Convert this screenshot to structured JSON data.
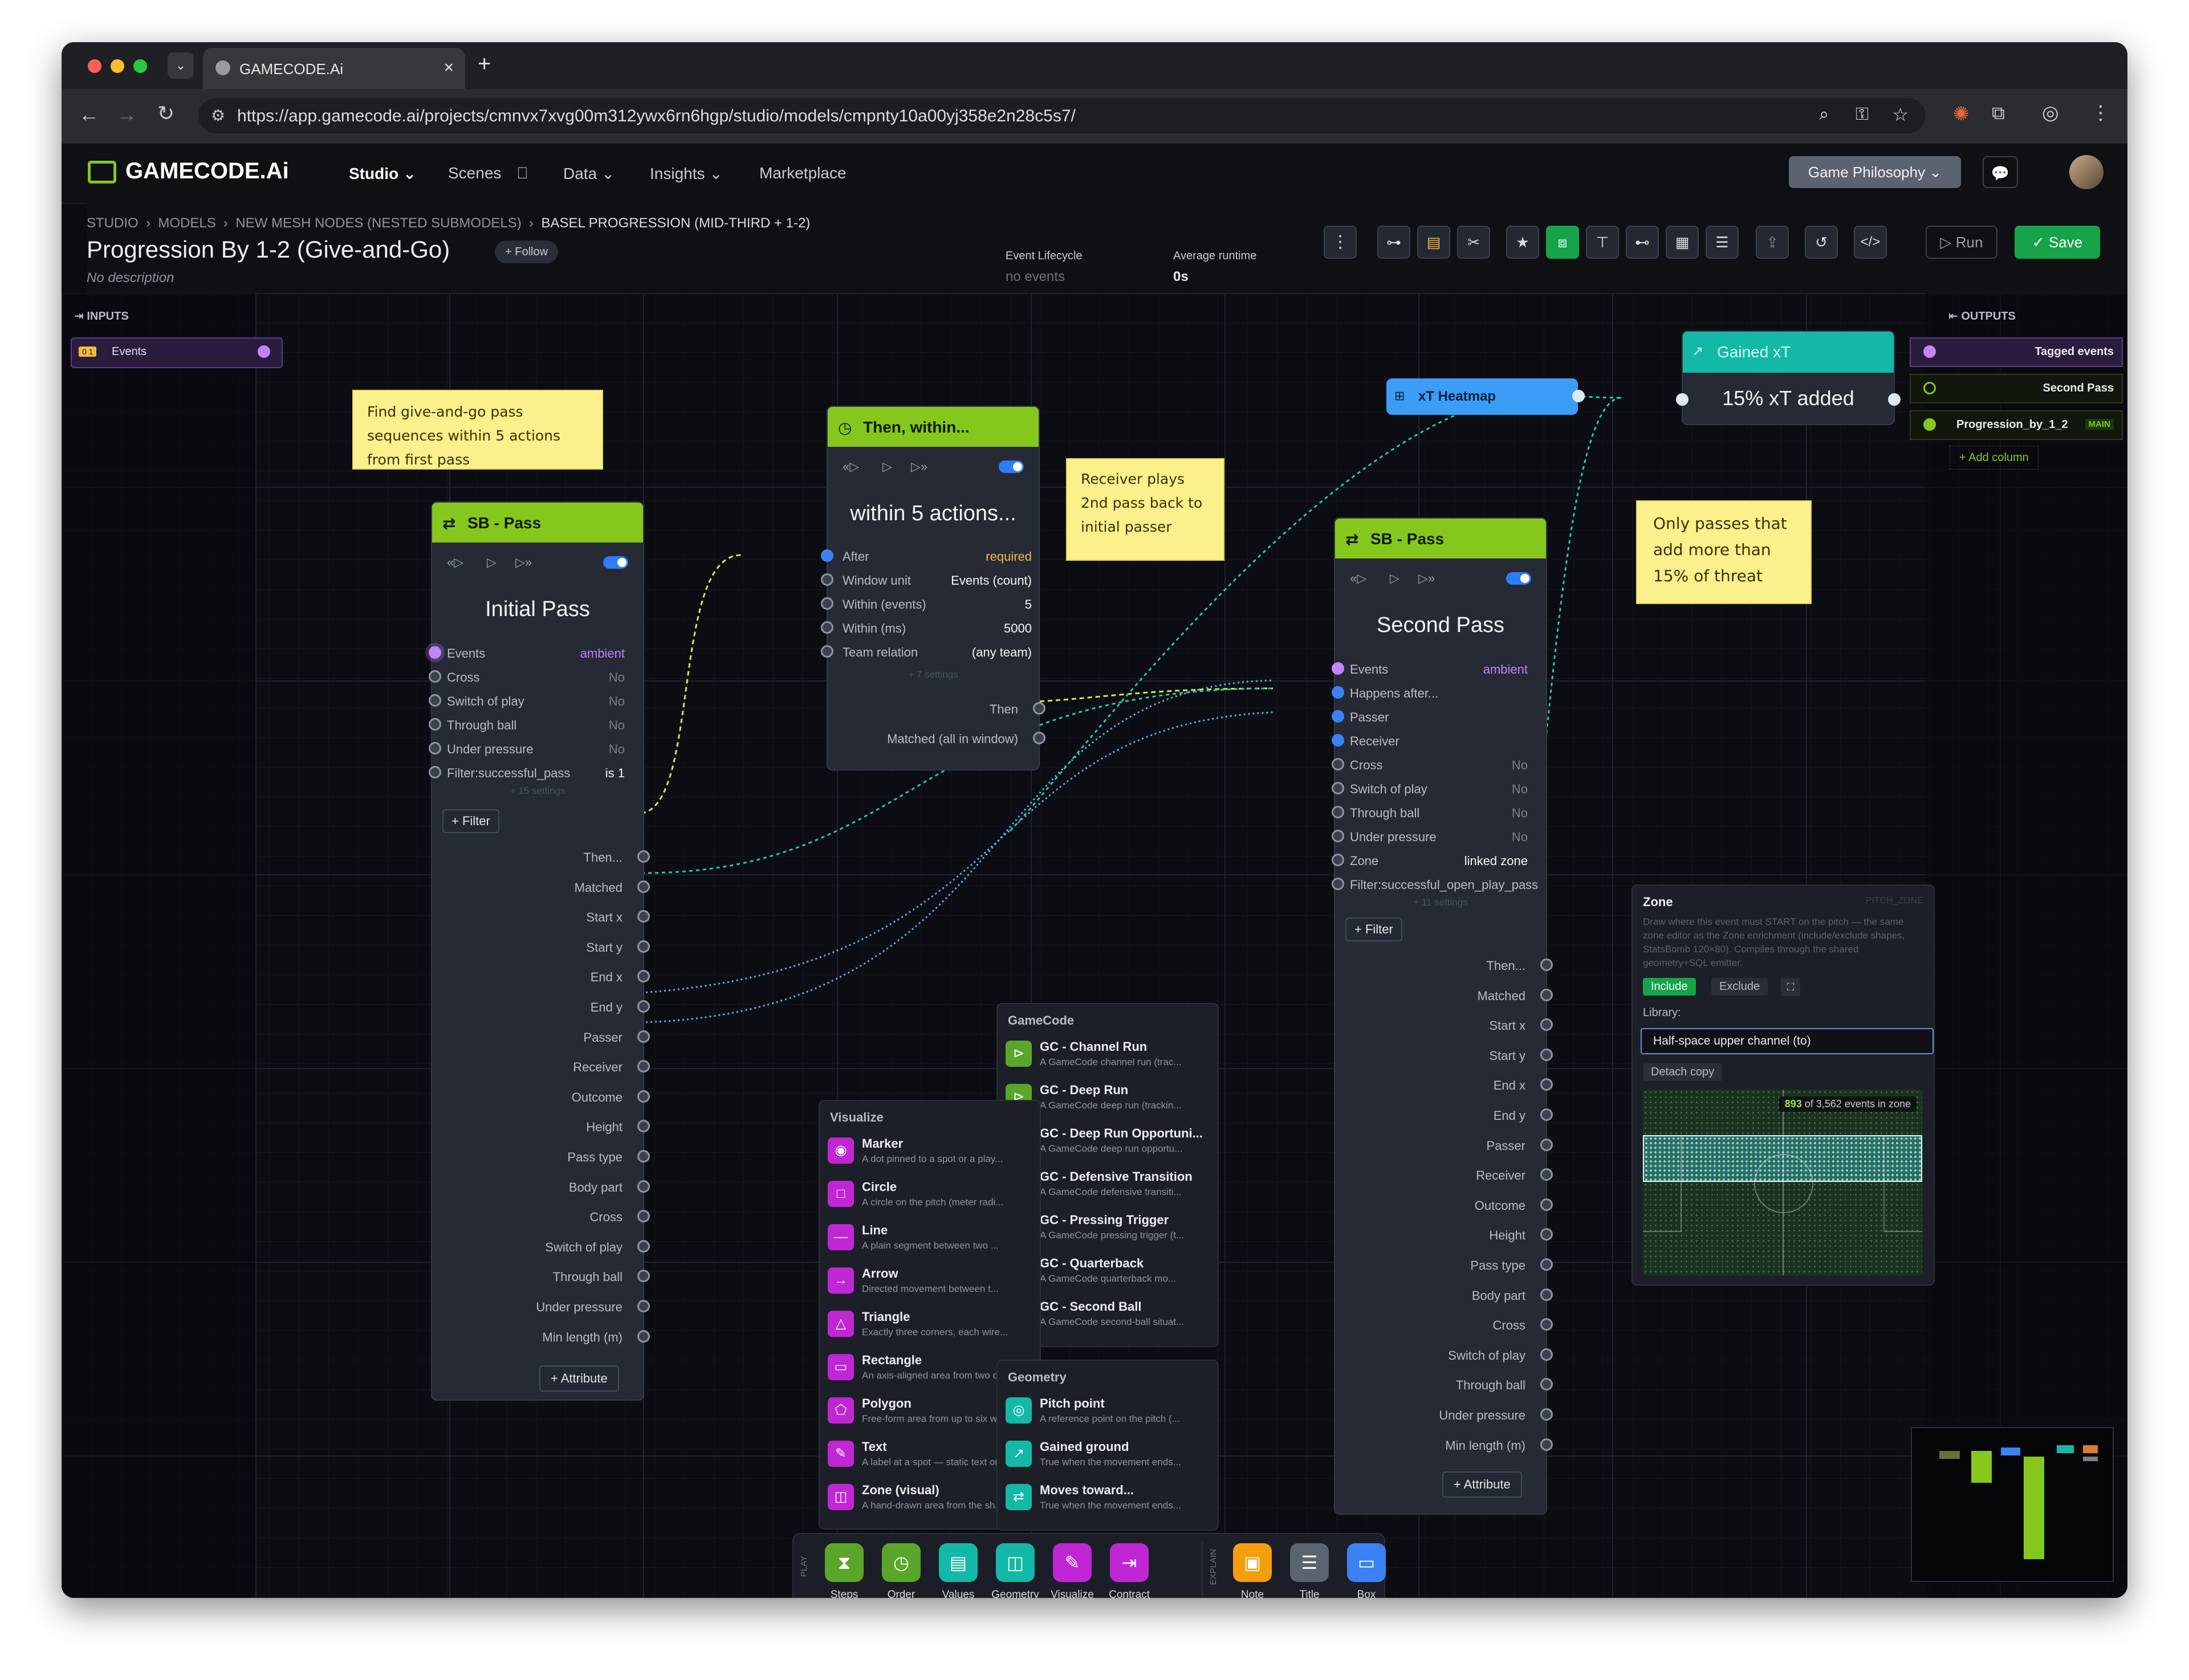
{
  "browser": {
    "tab_title": "GAMECODE.Ai",
    "url": "https://app.gamecode.ai/projects/cmnvx7xvg00m312ywx6rn6hgp/studio/models/cmpnty10a00yj358e2n28c5s7/"
  },
  "app": {
    "logo": "GAMECODE.Ai",
    "nav": [
      "Studio",
      "Scenes",
      "Data",
      "Insights",
      "Marketplace"
    ],
    "philosophy_button": "Game Philosophy"
  },
  "page": {
    "breadcrumb": [
      "STUDIO",
      "MODELS",
      "NEW MESH NODES (NESTED SUBMODELS)",
      "BASEL PROGRESSION (MID-THIRD + 1-2)"
    ],
    "title": "Progression By 1-2 (Give-and-Go)",
    "follow": "+ Follow",
    "description": "No description",
    "event_lifecycle_label": "Event Lifecycle",
    "event_lifecycle_value": "no events",
    "avg_runtime_label": "Average runtime",
    "avg_runtime_value": "0s",
    "run": "Run",
    "save": "Save"
  },
  "inputs": {
    "label": "INPUTS",
    "badge": "0 1",
    "item": "Events"
  },
  "outputs": {
    "label": "OUTPUTS",
    "rows": [
      "Tagged events",
      "Second Pass",
      "Progression_by_1_2"
    ],
    "main_badge": "MAIN",
    "add": "+ Add column"
  },
  "notes": [
    "Find give-and-go pass sequences within 5 actions from first pass",
    "Receiver plays 2nd pass back to initial passer",
    "Only passes that add more than 15% of threat"
  ],
  "node_initial": {
    "header": "SB - Pass",
    "title": "Initial Pass",
    "filters": [
      {
        "label": "Events",
        "value": "ambient"
      },
      {
        "label": "Cross",
        "value": "No"
      },
      {
        "label": "Switch of play",
        "value": "No"
      },
      {
        "label": "Through ball",
        "value": "No"
      },
      {
        "label": "Under pressure",
        "value": "No"
      },
      {
        "label": "Filter:successful_pass",
        "value": "is 1"
      }
    ],
    "more": "+ 15 settings",
    "filter_btn": "+ Filter",
    "outputs": [
      "Then...",
      "Matched",
      "Start x",
      "Start y",
      "End x",
      "End y",
      "Passer",
      "Receiver",
      "Outcome",
      "Height",
      "Pass type",
      "Body part",
      "Cross",
      "Switch of play",
      "Through ball",
      "Under pressure",
      "Min length (m)"
    ],
    "attr_btn": "+ Attribute"
  },
  "node_within": {
    "header": "Then, within...",
    "title": "within 5 actions...",
    "rows": [
      {
        "label": "After",
        "value": "required"
      },
      {
        "label": "Window unit",
        "value": "Events (count)"
      },
      {
        "label": "Within (events)",
        "value": "5"
      },
      {
        "label": "Within (ms)",
        "value": "5000"
      },
      {
        "label": "Team relation",
        "value": "(any team)"
      }
    ],
    "more": "+ 7 settings",
    "outputs": [
      "Then",
      "Matched (all in window)"
    ]
  },
  "node_second": {
    "header": "SB - Pass",
    "title": "Second Pass",
    "filters": [
      {
        "label": "Events",
        "value": "ambient"
      },
      {
        "label": "Happens after...",
        "value": ""
      },
      {
        "label": "Passer",
        "value": ""
      },
      {
        "label": "Receiver",
        "value": ""
      },
      {
        "label": "Cross",
        "value": "No"
      },
      {
        "label": "Switch of play",
        "value": "No"
      },
      {
        "label": "Through ball",
        "value": "No"
      },
      {
        "label": "Under pressure",
        "value": "No"
      },
      {
        "label": "Zone",
        "value": "linked zone"
      },
      {
        "label": "Filter:successful_open_play_pass",
        "value": ""
      }
    ],
    "more": "+ 11 settings",
    "filter_btn": "+ Filter",
    "outputs": [
      "Then...",
      "Matched",
      "Start x",
      "Start y",
      "End x",
      "End y",
      "Passer",
      "Receiver",
      "Outcome",
      "Height",
      "Pass type",
      "Body part",
      "Cross",
      "Switch of play",
      "Through ball",
      "Under pressure",
      "Min length (m)"
    ],
    "attr_btn": "+ Attribute"
  },
  "heatmap_node": {
    "label": "xT Heatmap"
  },
  "xt_node": {
    "header": "Gained xT",
    "value": "15% xT added"
  },
  "zone_panel": {
    "title": "Zone",
    "tag": "PITCH_ZONE",
    "desc": "Draw where this event must START on the pitch — the same zone editor as the Zone enrichment (include/exclude shapes, StatsBomb 120×80). Compiles through the shared geometry+SQL emitter.",
    "include": "Include",
    "exclude": "Exclude",
    "library_label": "Library:",
    "library_value": "Half-space upper channel (to)",
    "detach": "Detach copy",
    "count": "893",
    "count_rest": "of 3,562 events in zone"
  },
  "gamecode_panel": {
    "title": "GameCode",
    "items": [
      {
        "t": "GC - Channel Run",
        "d": "A GameCode channel run (trac..."
      },
      {
        "t": "GC - Deep Run",
        "d": "A GameCode deep run (trackin..."
      },
      {
        "t": "GC - Deep Run Opportuni...",
        "d": "A GameCode deep run opportu..."
      },
      {
        "t": "GC - Defensive Transition",
        "d": "A GameCode defensive transiti..."
      },
      {
        "t": "GC - Pressing Trigger",
        "d": "A GameCode pressing trigger (t..."
      },
      {
        "t": "GC - Quarterback",
        "d": "A GameCode quarterback mo..."
      },
      {
        "t": "GC - Second Ball",
        "d": "A GameCode second-ball situat..."
      }
    ]
  },
  "visualize_panel": {
    "title": "Visualize",
    "items": [
      {
        "t": "Marker",
        "d": "A dot pinned to a spot or a play..."
      },
      {
        "t": "Circle",
        "d": "A circle on the pitch (meter radi..."
      },
      {
        "t": "Line",
        "d": "A plain segment between two ..."
      },
      {
        "t": "Arrow",
        "d": "Directed movement between t..."
      },
      {
        "t": "Triangle",
        "d": "Exactly three corners, each wire..."
      },
      {
        "t": "Rectangle",
        "d": "An axis-aligned area from two o..."
      },
      {
        "t": "Polygon",
        "d": "Free-form area from up to six w..."
      },
      {
        "t": "Text",
        "d": "A label at a spot — static text or ..."
      },
      {
        "t": "Zone (visual)",
        "d": "A hand-drawn area from the sh..."
      }
    ]
  },
  "geometry_panel": {
    "title": "Geometry",
    "items": [
      {
        "t": "Pitch point",
        "d": "A reference point on the pitch (..."
      },
      {
        "t": "Gained ground",
        "d": "True when the movement ends..."
      },
      {
        "t": "Moves toward...",
        "d": "True when the movement ends..."
      }
    ]
  },
  "dock": {
    "play_label": "PLAY",
    "explain_label": "EXPLAIN",
    "play": [
      "Steps",
      "Order",
      "Values",
      "Geometry",
      "Visualize",
      "Contract"
    ],
    "explain": [
      "Note",
      "Title",
      "Box"
    ]
  },
  "colors": {
    "accent_green": "#86c71d",
    "save_green": "#16a34a",
    "teal": "#14b8a6",
    "violet": "#c084fc",
    "note_yellow": "#faf08c"
  }
}
